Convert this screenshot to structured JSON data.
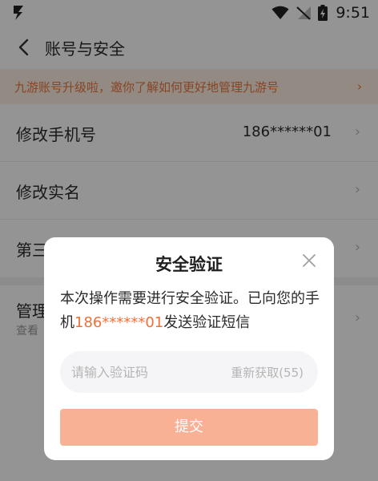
{
  "status_bar": {
    "app_logo": "Ϟ",
    "time": "9:51"
  },
  "header": {
    "back_icon": "back-chevron-icon",
    "title": "账号与安全"
  },
  "banner": {
    "text": "九游账号升级啦，邀你了解如何更好地管理九游号",
    "arrow": "›"
  },
  "list": {
    "change_phone": {
      "label": "修改手机号",
      "value": "186******01",
      "chevron": "›"
    },
    "change_realname": {
      "label": "修改实名",
      "chevron": "›"
    },
    "third_party": {
      "label": "第三",
      "chevron": "›"
    },
    "manage": {
      "label": "管理",
      "sub": "查看",
      "chevron": "›"
    }
  },
  "dialog": {
    "title": "安全验证",
    "message_prefix": "本次操作需要进行安全验证。已向您的手机",
    "message_phone": "186******01",
    "message_suffix": "发送验证短信",
    "code_placeholder": "请输入验证码",
    "resend_label": "重新获取(55)",
    "submit_label": "提交"
  },
  "colors": {
    "accent": "#f0703a",
    "banner_bg": "#fdeee4",
    "submit_disabled": "#f9b196"
  }
}
